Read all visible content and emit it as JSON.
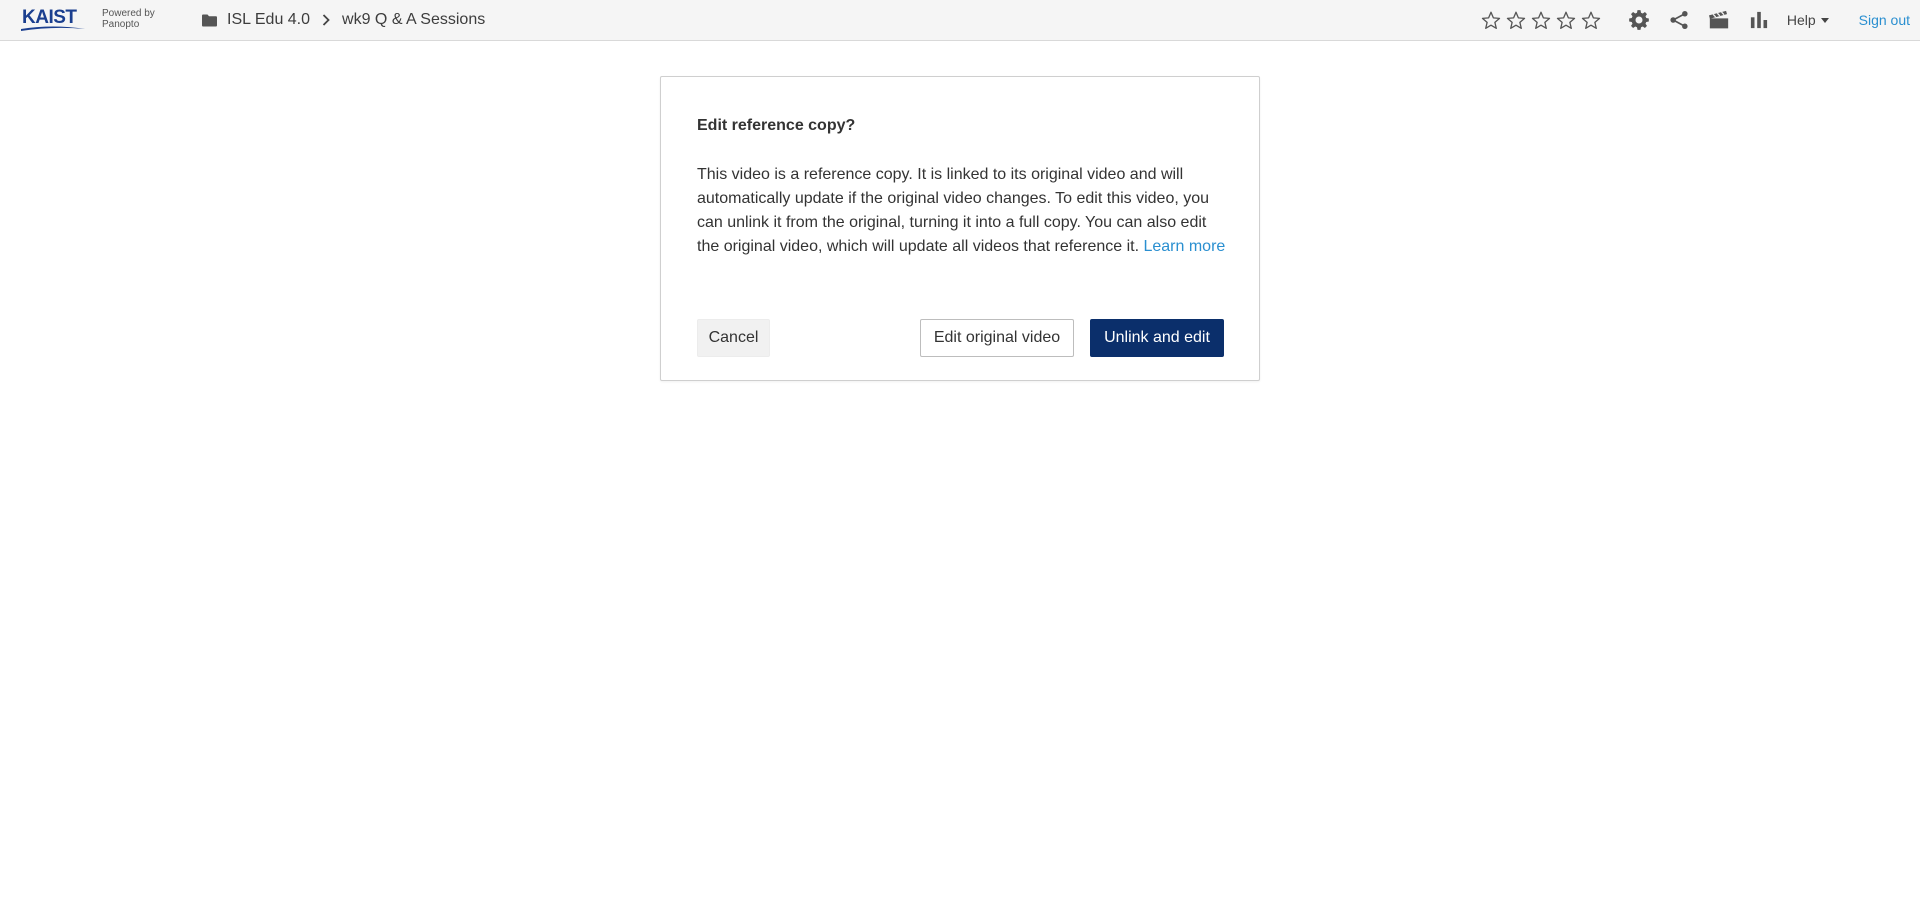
{
  "header": {
    "brand": {
      "name": "KAIST",
      "powered_line1": "Powered by",
      "powered_line2": "Panopto"
    },
    "breadcrumb": {
      "folder": "ISL Edu 4.0",
      "session": "wk9 Q & A Sessions"
    },
    "rating": {
      "max": 5,
      "value": 0
    },
    "icons": [
      "gear-icon",
      "share-icon",
      "clapperboard-icon",
      "bar-chart-icon"
    ],
    "help_label": "Help",
    "signout_label": "Sign out"
  },
  "dialog": {
    "title": "Edit reference copy?",
    "body": "This video is a reference copy. It is linked to its original video and will automatically update if the original video changes. To edit this video, you can unlink it from the original, turning it into a full copy. You can also edit the original video, which will update all videos that reference it.",
    "learn_more": "Learn more",
    "cancel_label": "Cancel",
    "edit_original_label": "Edit original video",
    "unlink_label": "Unlink and edit"
  },
  "colors": {
    "header_bg": "#f5f5f5",
    "link": "#2a8fd0",
    "primary_button": "#0b2f6b",
    "brand": "#1b3f8f",
    "icon": "#555555"
  }
}
